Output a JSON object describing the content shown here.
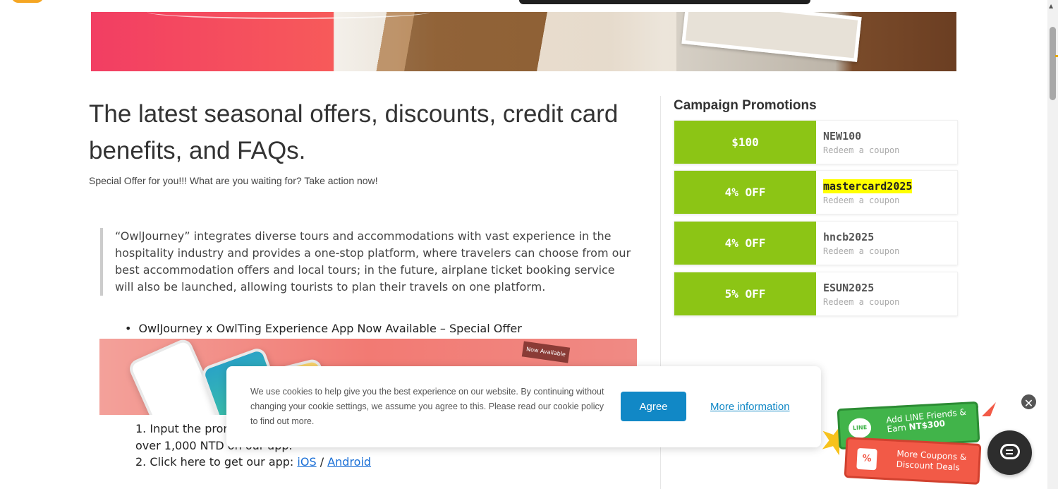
{
  "main": {
    "title": "The latest seasonal offers, discounts, credit card benefits, and FAQs.",
    "subtitle": "Special Offer for you!!! What are you waiting for? Take action now!",
    "quote": "“OwlJourney” integrates diverse tours and accommodations with vast experience in the hospitality industry and provides a one-stop platform, where travelers can choose from our best accommodation offers and local tours; in the future, airplane ticket booking service will also be launched, allowing tourists to plan their travels on one platform.",
    "bullet": "OwlJourney x OwlTing Experience App Now Available – Special Offer",
    "banner_tag": "Now Available",
    "steps": {
      "step1_num": "1.",
      "step1": "Input the promo",
      "step1_cont": "over 1,000 NTD on our app.",
      "step2_num": "2.",
      "step2_prefix": "Click here to get our app:",
      "ios": "iOS",
      "sep": "/",
      "android": "Android"
    }
  },
  "sidebar": {
    "title": "Campaign Promotions",
    "coupons": [
      {
        "amount": "$100",
        "code": "NEW100",
        "action": "Redeem a coupon"
      },
      {
        "amount": "4% OFF",
        "code": "mastercard2025",
        "action": "Redeem a coupon"
      },
      {
        "amount": "4% OFF",
        "code": "hncb2025",
        "action": "Redeem a coupon"
      },
      {
        "amount": "5% OFF",
        "code": "ESUN2025",
        "action": "Redeem a coupon"
      }
    ]
  },
  "cookie": {
    "text": "We use cookies to help give you the best experience on our website. By continuing without changing your cookie settings, we assume you agree to this. Please read our cookie policy to find out more.",
    "agree": "Agree",
    "more": "More information"
  },
  "promo": {
    "line_badge": "LINE",
    "line_text": "Add LINE Friends &",
    "line_earn_prefix": "Earn",
    "line_earn_amount": "NT$300",
    "gift_symbol": "%",
    "coupon_line1": "More Coupons &",
    "coupon_line2": "Discount Deals",
    "close": "✕"
  },
  "colors": {
    "coupon_green": "#8cc515",
    "agree_blue": "#1188c6",
    "line_green": "#41b44a",
    "promo_red": "#f25a47"
  }
}
